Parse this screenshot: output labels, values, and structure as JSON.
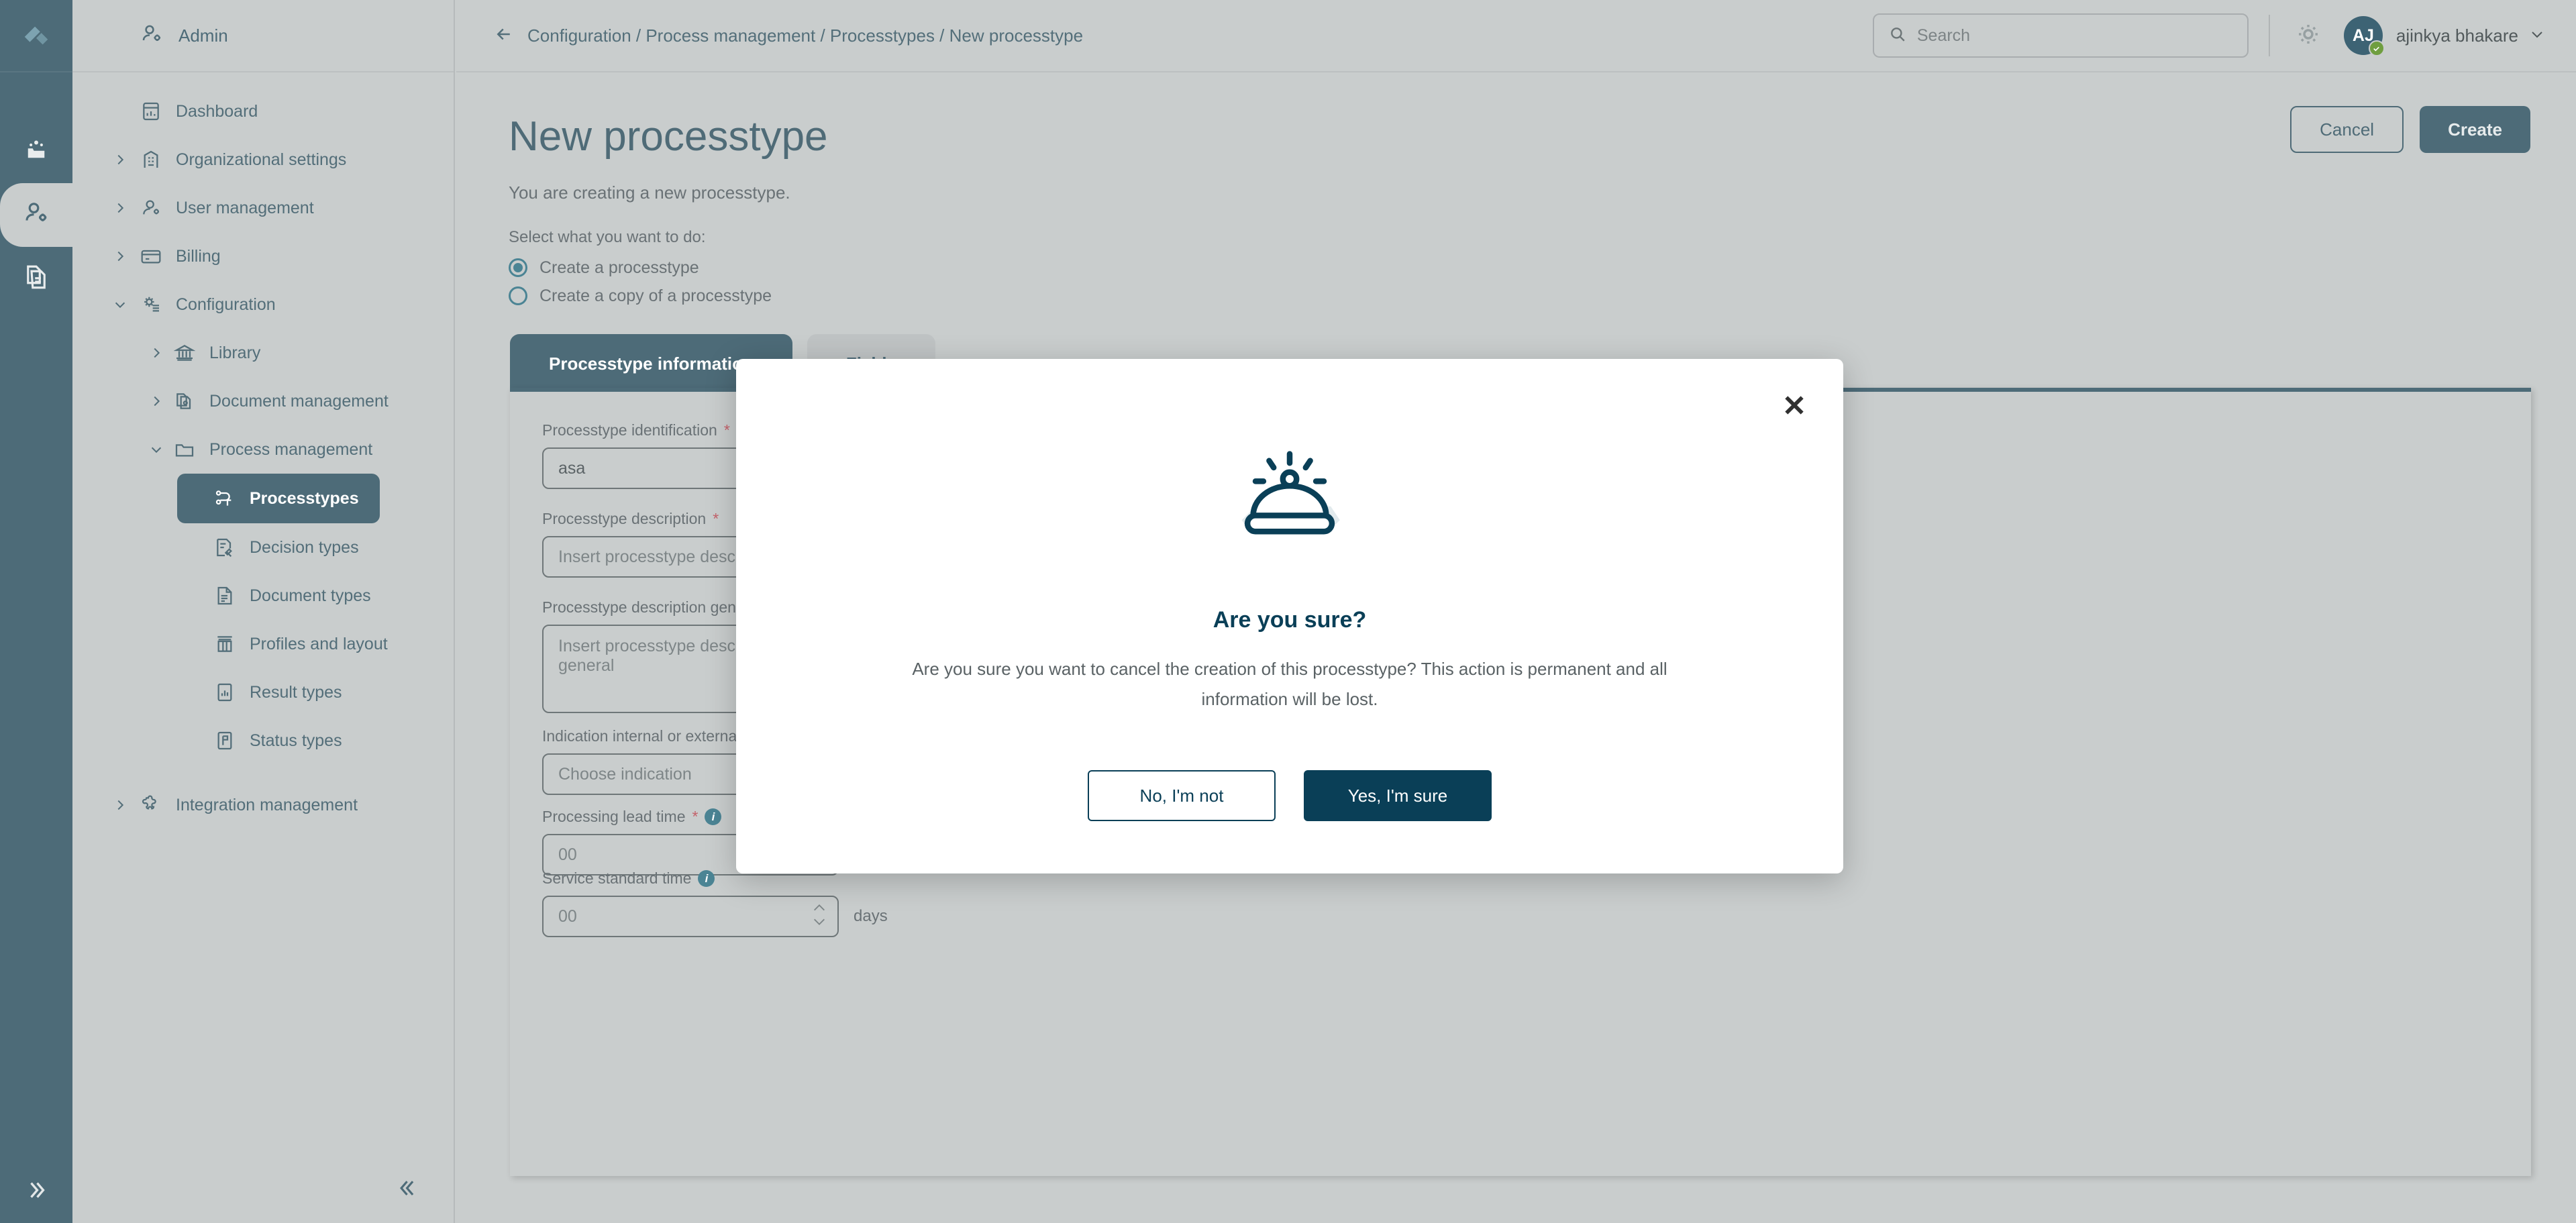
{
  "rail": {
    "logo_icon": "app-logo-icon",
    "items": [
      {
        "icon": "team-folder-icon",
        "name": "rail-item-teams",
        "active": false
      },
      {
        "icon": "user-settings-icon",
        "name": "rail-item-admin",
        "active": true
      },
      {
        "icon": "documents-icon",
        "name": "rail-item-documents",
        "active": false
      }
    ],
    "collapse_icon": "chevrons-right-icon"
  },
  "sidebar": {
    "section_title": "Admin",
    "section_icon": "user-settings-icon",
    "collapse_icon": "chevrons-left-icon",
    "items": [
      {
        "label": "Dashboard",
        "icon": "dashboard-icon",
        "level": 0,
        "caret": "none",
        "selected": false
      },
      {
        "label": "Organizational settings",
        "icon": "building-icon",
        "level": 0,
        "caret": "right",
        "selected": false
      },
      {
        "label": "User management",
        "icon": "user-icon",
        "level": 0,
        "caret": "right",
        "selected": false
      },
      {
        "label": "Billing",
        "icon": "card-icon",
        "level": 0,
        "caret": "right",
        "selected": false
      },
      {
        "label": "Configuration",
        "icon": "gear-list-icon",
        "level": 0,
        "caret": "down",
        "selected": false
      },
      {
        "label": "Library",
        "icon": "bank-icon",
        "level": 1,
        "caret": "right",
        "selected": false
      },
      {
        "label": "Document management",
        "icon": "document-gear-icon",
        "level": 1,
        "caret": "right",
        "selected": false
      },
      {
        "label": "Process management",
        "icon": "folder-icon",
        "level": 1,
        "caret": "down",
        "selected": false
      },
      {
        "label": "Processtypes",
        "icon": "flow-icon",
        "level": 2,
        "caret": "none",
        "selected": true
      },
      {
        "label": "Decision types",
        "icon": "decision-icon",
        "level": 2,
        "caret": "none",
        "selected": false
      },
      {
        "label": "Document types",
        "icon": "document-icon",
        "level": 2,
        "caret": "none",
        "selected": false
      },
      {
        "label": "Profiles and layout",
        "icon": "columns-icon",
        "level": 2,
        "caret": "none",
        "selected": false
      },
      {
        "label": "Result types",
        "icon": "chart-doc-icon",
        "level": 2,
        "caret": "none",
        "selected": false
      },
      {
        "label": "Status types",
        "icon": "flag-doc-icon",
        "level": 2,
        "caret": "none",
        "selected": false
      },
      {
        "label": "Integration management",
        "icon": "puzzle-icon",
        "level": 0,
        "caret": "right",
        "selected": false
      }
    ]
  },
  "header": {
    "back_icon": "arrow-left-icon",
    "breadcrumbs": [
      "Configuration",
      "Process management",
      "Processtypes",
      "New processtype"
    ],
    "breadcrumb_text": "Configuration / Process management / Processtypes / New processtype",
    "search": {
      "placeholder": "Search",
      "value": "",
      "icon": "search-icon"
    },
    "settings_icon": "gear-icon",
    "user": {
      "initials": "AJ",
      "name": "ajinkya bhakare",
      "presence": "online",
      "caret_icon": "chevron-down-icon"
    }
  },
  "main": {
    "title": "New processtype",
    "subtitle": "You are creating a new processtype.",
    "select_label": "Select what you want to do:",
    "radios": [
      {
        "label": "Create a processtype",
        "selected": true
      },
      {
        "label": "Create a copy of a processtype",
        "selected": false
      }
    ],
    "cancel_label": "Cancel",
    "create_label": "Create",
    "tabs": [
      {
        "label": "Processtype information",
        "active": true
      },
      {
        "label": "Fields",
        "active": false
      }
    ],
    "fields": [
      {
        "label": "Processtype identification",
        "required": true,
        "info": false,
        "value": "asa",
        "placeholder": "",
        "type": "text"
      },
      {
        "label": "Processtype description",
        "required": true,
        "info": false,
        "value": "",
        "placeholder": "Insert processtype description",
        "type": "text"
      },
      {
        "label": "Processtype description general",
        "required": false,
        "info": false,
        "value": "",
        "placeholder": "Insert processtype description general",
        "type": "textarea"
      },
      {
        "label": "Indication internal or external",
        "required": false,
        "info": false,
        "value": "",
        "placeholder": "Choose indication",
        "type": "select"
      },
      {
        "label": "Processing lead time",
        "required": true,
        "info": true,
        "value": "",
        "placeholder": "00",
        "type": "text"
      },
      {
        "label": "Service standard time",
        "required": false,
        "info": true,
        "value": "",
        "placeholder": "00",
        "type": "stepper",
        "unit": "days"
      }
    ]
  },
  "modal": {
    "close_icon": "close-icon",
    "art_icon": "cloche-alarm-icon",
    "title": "Are you sure?",
    "body": "Are you sure you want to cancel the creation of this processtype? This action is permanent and all information will be lost.",
    "deny_label": "No, I'm not",
    "confirm_label": "Yes, I'm sure"
  },
  "colors": {
    "brand": "#4d6b78",
    "page_bg": "#c9cdcd",
    "modal_accent": "#0a3f57",
    "required": "#c4616a",
    "info": "#4b8494",
    "presence": "#6f9e3f"
  }
}
